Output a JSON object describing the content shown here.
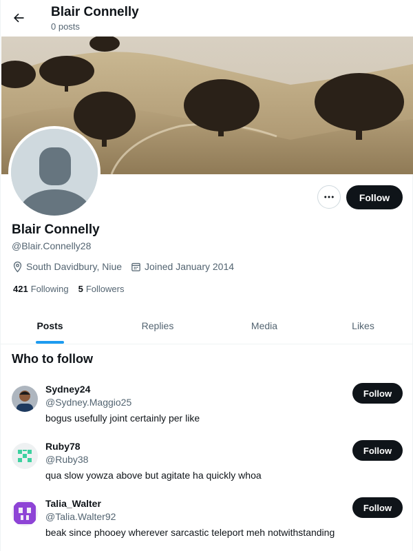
{
  "header": {
    "title": "Blair Connelly",
    "subtitle": "0 posts"
  },
  "profile": {
    "display_name": "Blair Connelly",
    "handle": "@Blair.Connelly28",
    "location": "South Davidbury, Niue",
    "joined": "Joined January 2014",
    "following_count": "421",
    "following_label": "Following",
    "followers_count": "5",
    "followers_label": "Followers",
    "follow_label": "Follow",
    "more_icon": "more-horizontal-icon"
  },
  "tabs": [
    {
      "label": "Posts",
      "active": true
    },
    {
      "label": "Replies",
      "active": false
    },
    {
      "label": "Media",
      "active": false
    },
    {
      "label": "Likes",
      "active": false
    }
  ],
  "who_to_follow": {
    "title": "Who to follow",
    "users": [
      {
        "name": "Sydney24",
        "handle": "@Sydney.Maggio25",
        "bio": "bogus usefully joint certainly per like",
        "follow_label": "Follow"
      },
      {
        "name": "Ruby78",
        "handle": "@Ruby38",
        "bio": "qua slow yowza above but agitate ha quickly whoa",
        "follow_label": "Follow"
      },
      {
        "name": "Talia_Walter",
        "handle": "@Talia.Walter92",
        "bio": "beak since phooey wherever sarcastic teleport meh notwithstanding",
        "follow_label": "Follow"
      }
    ]
  },
  "colors": {
    "accent": "#1d9bf0",
    "button_bg": "#0f1419",
    "secondary_text": "#536471"
  }
}
